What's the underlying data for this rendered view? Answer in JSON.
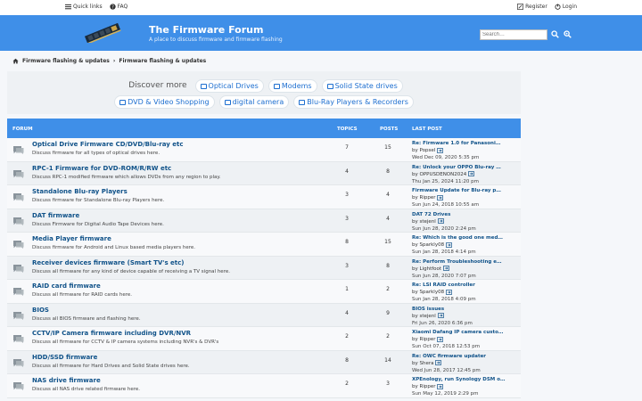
{
  "topbar": {
    "quick_links": "Quick links",
    "faq": "FAQ",
    "register": "Register",
    "login": "Login"
  },
  "header": {
    "title": "The Firmware Forum",
    "description": "A place to discuss firmware and firmware flashing",
    "search_placeholder": "Search…"
  },
  "breadcrumb": {
    "items": [
      "Firmware flashing & updates",
      "Firmware flashing & updates"
    ]
  },
  "discover": {
    "label": "Discover more",
    "row1": [
      "Optical Drives",
      "Modems",
      "Solid State drives"
    ],
    "row2": [
      "DVD & Video Shopping",
      "digital camera",
      "Blu-Ray Players & Recorders"
    ]
  },
  "table": {
    "col_forum": "FORUM",
    "col_topics": "TOPICS",
    "col_posts": "POSTS",
    "col_last": "LAST POST",
    "rows": [
      {
        "title": "Optical Drive Firmware CD/DVD/Blu-ray etc",
        "desc": "Discuss firmware for all types of optical drives here.",
        "topics": "7",
        "posts": "15",
        "last_title": "Re: Firmware 1.0 for Panasoni…",
        "by": "Popsel",
        "date": "Wed Dec 09, 2020 5:35 pm"
      },
      {
        "title": "RPC-1 Firmware for DVD-ROM/R/RW etc",
        "desc": "Discuss RPC-1 modified firmware which allows DVDs from any region to play.",
        "topics": "4",
        "posts": "8",
        "last_title": "Re: Unlock your OPPO Blu-ray …",
        "by": "OPPUSDENON2024",
        "date": "Thu Jan 25, 2024 11:20 pm"
      },
      {
        "title": "Standalone Blu-ray Players",
        "desc": "Discuss firmware for Standalone Blu-ray Players here.",
        "topics": "3",
        "posts": "4",
        "last_title": "Firmware Update for Blu-ray p…",
        "by": "Ripper",
        "date": "Sun Jun 24, 2018 10:55 am"
      },
      {
        "title": "DAT firmware",
        "desc": "Discuss Firmware for Digital Audio Tape Devices here.",
        "topics": "3",
        "posts": "4",
        "last_title": "DAT 72 Drives",
        "by": "stejenl",
        "date": "Sun Jun 28, 2020 2:24 pm"
      },
      {
        "title": "Media Player firmware",
        "desc": "Discuss firmware for Android and Linux based media players here.",
        "topics": "8",
        "posts": "15",
        "last_title": "Re: Which is the good one med…",
        "by": "Sparkly08",
        "date": "Sun Jan 28, 2018 4:14 pm"
      },
      {
        "title": "Receiver devices firmware (Smart TV's etc)",
        "desc": "Discuss all firmware for any kind of device capable of receiving a TV signal here.",
        "topics": "3",
        "posts": "8",
        "last_title": "Re: Perform Troubleshooting e…",
        "by": "Lightfoot",
        "date": "Sun Jun 28, 2020 7:07 pm"
      },
      {
        "title": "RAID card firmware",
        "desc": "Discuss all firmware for RAID cards here.",
        "topics": "1",
        "posts": "2",
        "last_title": "Re: LSI RAID controller",
        "by": "Sparkly08",
        "date": "Sun Jan 28, 2018 4:09 pm"
      },
      {
        "title": "BIOS",
        "desc": "Discuss all BIOS firmware and flashing here.",
        "topics": "4",
        "posts": "9",
        "last_title": "BIOS issues",
        "by": "stejenl",
        "date": "Fri Jun 26, 2020 6:36 pm"
      },
      {
        "title": "CCTV/IP Camera firmware including DVR/NVR",
        "desc": "Discuss all firmware for CCTV & IP camera systems including NVR's & DVR's",
        "topics": "2",
        "posts": "2",
        "last_title": "Xiaomi Dafang IP camera custo…",
        "by": "Ripper",
        "date": "Sun Oct 07, 2018 12:53 pm"
      },
      {
        "title": "HDD/SSD firmware",
        "desc": "Discuss all firmware for Hard Drives and Solid State drives here.",
        "topics": "8",
        "posts": "14",
        "last_title": "Re: OWC firmware updater",
        "by": "Shera",
        "date": "Wed Jun 28, 2017 12:45 pm"
      },
      {
        "title": "NAS drive firmware",
        "desc": "Discuss all NAS drive related firmware here.",
        "topics": "2",
        "posts": "3",
        "last_title": "XPEnology, run Synology DSM o…",
        "by": "Ripper",
        "date": "Sun May 12, 2019 2:29 pm"
      }
    ]
  },
  "colors": {
    "accent": "#3f8fe8",
    "link": "#105289",
    "chip_text": "#1e6fd0"
  },
  "by_prefix": "by"
}
